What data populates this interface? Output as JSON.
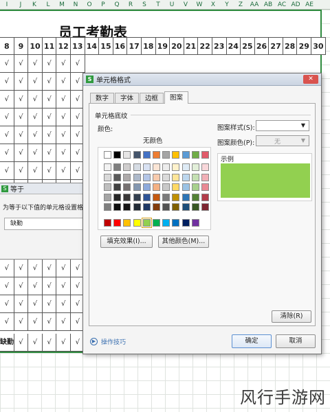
{
  "spreadsheet": {
    "column_letters": [
      "I",
      "J",
      "K",
      "L",
      "M",
      "N",
      "O",
      "P",
      "Q",
      "R",
      "S",
      "T",
      "U",
      "V",
      "W",
      "X",
      "Y",
      "Z",
      "AA",
      "AB",
      "AC",
      "AD",
      "AE"
    ],
    "title": "员工考勤表",
    "day_numbers": [
      "8",
      "9",
      "10",
      "11",
      "12",
      "13",
      "14",
      "15",
      "16",
      "17",
      "18",
      "19",
      "20",
      "21",
      "22",
      "23",
      "24",
      "25",
      "26",
      "27",
      "28",
      "29",
      "30"
    ],
    "check_mark": "√",
    "absence_text": "缺勤",
    "absence_cell_text": "缺勤"
  },
  "condition_dialog": {
    "title": "等于",
    "prompt": "为等于以下值的单元格设置格式",
    "value": "缺勤"
  },
  "format_dialog": {
    "title": "单元格格式",
    "close_label": "✕",
    "tabs": [
      {
        "label": "数字",
        "active": false
      },
      {
        "label": "字体",
        "active": false
      },
      {
        "label": "边框",
        "active": false
      },
      {
        "label": "图案",
        "active": true
      }
    ],
    "group_label": "单元格底纹",
    "color_label": "颜色:",
    "no_color_label": "无颜色",
    "fill_effect_button": "填充效果(I)...",
    "more_colors_button": "其他颜色(M)...",
    "pattern_style_label": "图案样式(S):",
    "pattern_color_label": "图案颜色(P):",
    "pattern_color_value": "无",
    "sample_label": "示例",
    "sample_color": "#92d050",
    "clear_button": "清除(R)",
    "tips_link": "操作技巧",
    "ok_button": "确定",
    "cancel_button": "取消",
    "theme_row": [
      "#ffffff",
      "#000000",
      "#e7e6e6",
      "#44546a",
      "#4472c4",
      "#ed7d31",
      "#a5a5a5",
      "#ffc000",
      "#5b9bd5",
      "#70ad47",
      "#e15b6b"
    ],
    "tint_rows": [
      [
        "#f2f2f2",
        "#7f7f7f",
        "#d0cece",
        "#d6dce4",
        "#d9e2f3",
        "#fbe5d5",
        "#ededed",
        "#fff2cc",
        "#deebf6",
        "#e2efd9",
        "#f8d7da"
      ],
      [
        "#d9d9d9",
        "#595959",
        "#aeaaaa",
        "#adb9ca",
        "#b4c6e7",
        "#f8cbad",
        "#dbdbdb",
        "#fee599",
        "#bdd7ee",
        "#c5e0b3",
        "#f1b0b7"
      ],
      [
        "#bfbfbf",
        "#404040",
        "#757070",
        "#8497b0",
        "#8eaadb",
        "#f4b183",
        "#c9c9c9",
        "#ffd966",
        "#9cc3e5",
        "#a8d08d",
        "#e98a95"
      ],
      [
        "#a6a6a6",
        "#262626",
        "#3a3838",
        "#333f4f",
        "#2f5496",
        "#c55a11",
        "#7b7b7b",
        "#bf9000",
        "#2e75b5",
        "#538135",
        "#b23d4a"
      ],
      [
        "#808080",
        "#0d0d0d",
        "#171616",
        "#222a35",
        "#1f3864",
        "#833c0b",
        "#525252",
        "#7f6000",
        "#1e4e79",
        "#375623",
        "#7d2631"
      ]
    ],
    "standard_row": [
      "#c00000",
      "#ff0000",
      "#ffc000",
      "#ffff00",
      "#92d050",
      "#00b050",
      "#00b0f0",
      "#0070c0",
      "#002060",
      "#7030a0"
    ],
    "selected_color": "#92d050"
  },
  "watermark": "风行手游网"
}
